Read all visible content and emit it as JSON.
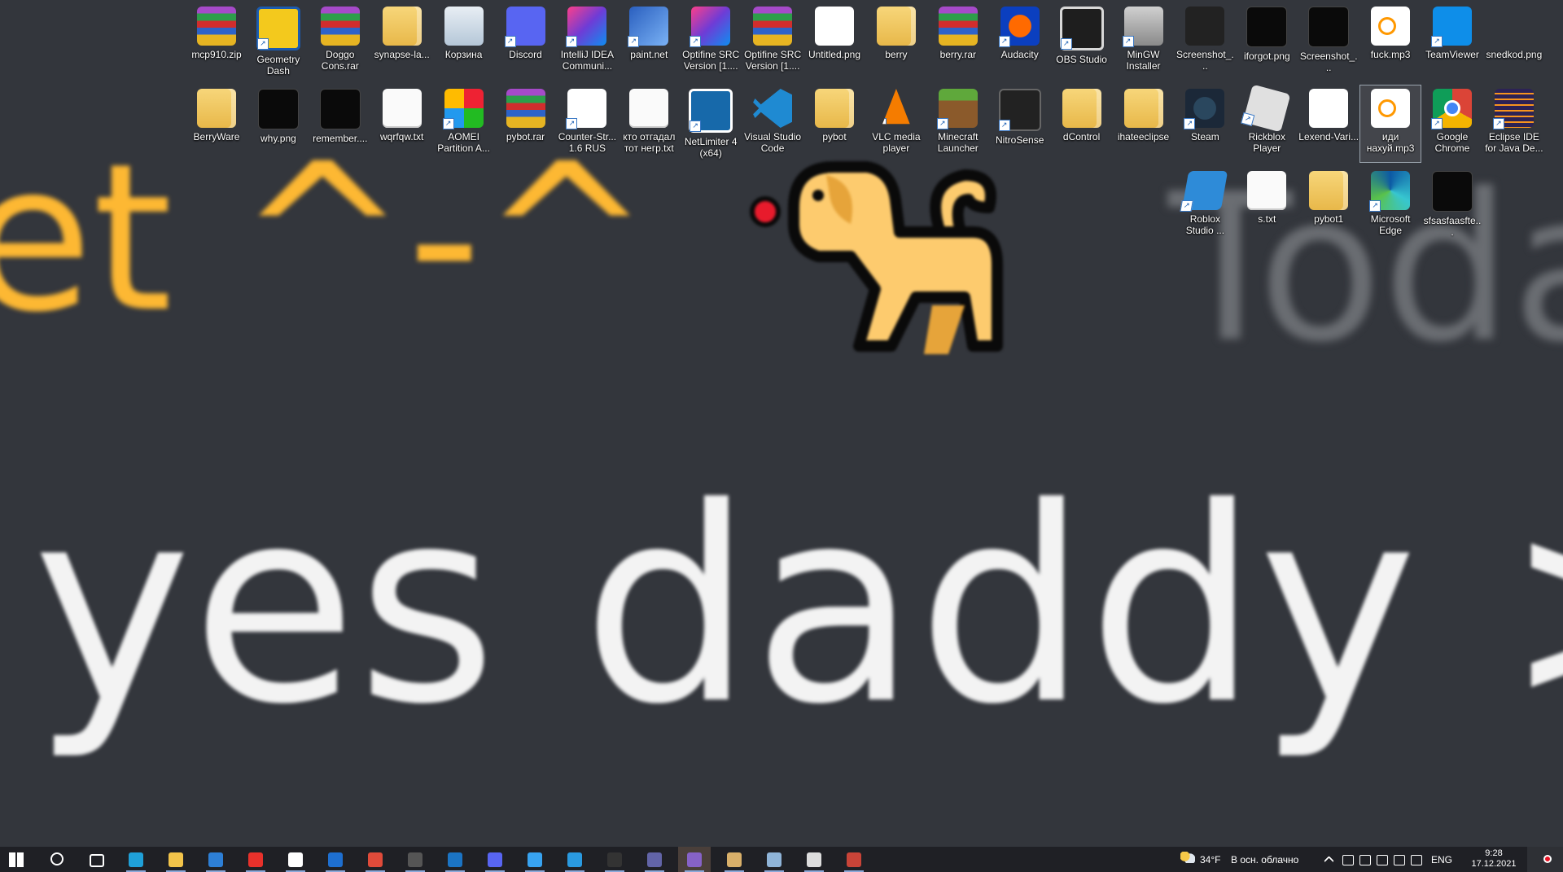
{
  "wallpaper": {
    "orange_text": "et ^-^",
    "gray_text": "Toda",
    "white_text": "yes daddy >w"
  },
  "desktop": {
    "row1": [
      {
        "label": "mcp910.zip",
        "icon": "winrar-archive-icon"
      },
      {
        "label": "Geometry Dash",
        "icon": "geometry-dash-icon"
      },
      {
        "label": "Doggo Cons.rar",
        "icon": "winrar-archive-icon"
      },
      {
        "label": "synapse-la...",
        "icon": "folder-icon"
      },
      {
        "label": "Корзина",
        "icon": "recycle-bin-icon"
      },
      {
        "label": "Discord",
        "icon": "discord-icon"
      },
      {
        "label": "IntelliJ IDEA Communi...",
        "icon": "intellij-idea-icon"
      },
      {
        "label": "paint.net",
        "icon": "paint-net-icon"
      },
      {
        "label": "Optifine SRC Version [1....",
        "icon": "intellij-project-icon"
      },
      {
        "label": "Optifine SRC Version [1....",
        "icon": "winrar-archive-icon"
      },
      {
        "label": "Untitled.png",
        "icon": "image-file-icon"
      },
      {
        "label": "berry",
        "icon": "folder-icon"
      },
      {
        "label": "berry.rar",
        "icon": "winrar-archive-icon"
      },
      {
        "label": "Audacity",
        "icon": "audacity-icon"
      },
      {
        "label": "OBS Studio",
        "icon": "obs-studio-icon"
      },
      {
        "label": "MinGW Installer",
        "icon": "mingw-installer-icon"
      },
      {
        "label": "Screenshot_...",
        "icon": "image-file-icon"
      },
      {
        "label": "iforgot.png",
        "icon": "image-file-icon"
      },
      {
        "label": "Screenshot_...",
        "icon": "image-file-icon"
      },
      {
        "label": "fuck.mp3",
        "icon": "mp3-file-icon"
      },
      {
        "label": "TeamViewer",
        "icon": "teamviewer-icon"
      },
      {
        "label": "snedkod.png",
        "icon": "image-file-icon"
      }
    ],
    "row2": [
      {
        "label": "BerryWare",
        "icon": "folder-icon"
      },
      {
        "label": "why.png",
        "icon": "image-file-icon"
      },
      {
        "label": "remember....",
        "icon": "image-file-icon"
      },
      {
        "label": "wqrfqw.txt",
        "icon": "text-file-icon"
      },
      {
        "label": "AOMEI Partition A...",
        "icon": "aomei-partition-icon"
      },
      {
        "label": "pybot.rar",
        "icon": "winrar-archive-icon"
      },
      {
        "label": "Counter-Str... 1.6 RUS",
        "icon": "counter-strike-icon"
      },
      {
        "label": "кто отгадал тот негр.txt",
        "icon": "text-file-icon"
      },
      {
        "label": "NetLimiter 4 (x64)",
        "icon": "netlimiter-icon"
      },
      {
        "label": "Visual Studio Code",
        "icon": "vscode-icon"
      },
      {
        "label": "pybot",
        "icon": "folder-icon"
      },
      {
        "label": "VLC media player",
        "icon": "vlc-icon"
      },
      {
        "label": "Minecraft Launcher",
        "icon": "minecraft-icon"
      },
      {
        "label": "NitroSense",
        "icon": "nitrosense-icon"
      },
      {
        "label": "dControl",
        "icon": "folder-icon"
      },
      {
        "label": "ihateeclipse",
        "icon": "folder-icon"
      },
      {
        "label": "Steam",
        "icon": "steam-icon"
      },
      {
        "label": "Rickblox Player",
        "icon": "roblox-player-icon"
      },
      {
        "label": "Lexend-Vari...",
        "icon": "font-file-icon"
      },
      {
        "label": "иди нахуй.mp3",
        "icon": "mp3-file-icon"
      },
      {
        "label": "Google Chrome",
        "icon": "chrome-icon"
      },
      {
        "label": "Eclipse IDE for Java De...",
        "icon": "eclipse-icon"
      }
    ],
    "row3": [
      {
        "label": "Roblox Studio ...",
        "icon": "roblox-studio-icon"
      },
      {
        "label": "s.txt",
        "icon": "text-file-icon"
      },
      {
        "label": "pybot1",
        "icon": "folder-icon"
      },
      {
        "label": "Microsoft Edge",
        "icon": "edge-icon"
      },
      {
        "label": "sfsasfaasfte...",
        "icon": "image-file-icon"
      }
    ]
  },
  "taskbar": {
    "apps": [
      "start-icon",
      "search-icon",
      "task-view-icon",
      "edge-icon",
      "file-explorer-icon",
      "mail-icon",
      "yandex-icon",
      "dropbox-icon",
      "security-shield-icon",
      "chrome-icon",
      "nitrosense-icon",
      "netlimiter-icon",
      "discord-icon",
      "roblox-studio-icon",
      "vscode-icon",
      "terminal-icon",
      "teams-icon",
      "visual-studio-icon",
      "paint-tool-icon",
      "notepad-icon",
      "counter-strike-icon",
      "reaper-icon"
    ],
    "weather_temp": "34°F",
    "weather_desc": "В осн. облачно",
    "language": "ENG",
    "time": "9:28",
    "date": "17.12.2021"
  },
  "colors": {
    "wallpaper_bg": "#33363c",
    "taskbar_bg": "#1f2025",
    "orange": "#fdb833"
  }
}
